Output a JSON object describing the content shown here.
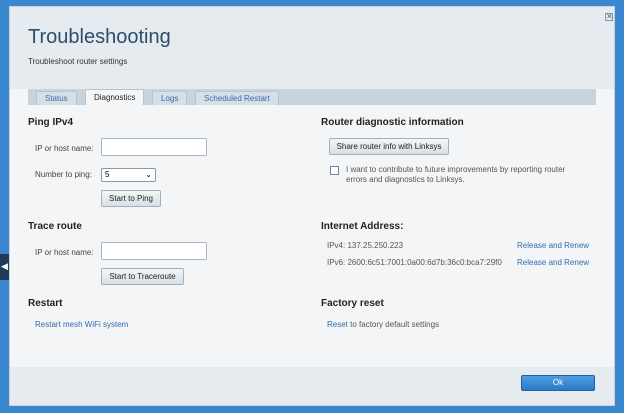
{
  "header": {
    "title": "Troubleshooting",
    "subtitle": "Troubleshoot router settings"
  },
  "tabs": [
    {
      "label": "Status"
    },
    {
      "label": "Diagnostics"
    },
    {
      "label": "Logs"
    },
    {
      "label": "Scheduled Restart"
    }
  ],
  "ping": {
    "title": "Ping IPv4",
    "host_label": "IP or host name:",
    "host_value": "",
    "count_label": "Number to ping:",
    "count_value": "5",
    "button": "Start to Ping"
  },
  "trace": {
    "title": "Trace route",
    "host_label": "IP or host name:",
    "host_value": "",
    "button": "Start to Traceroute"
  },
  "restart": {
    "title": "Restart",
    "link": "Restart mesh WiFi system"
  },
  "router_diag": {
    "title": "Router diagnostic information",
    "share_button": "Share router info with Linksys",
    "consent_line1": "I want to contribute to future improvements by reporting router",
    "consent_line2": "errors and diagnostics to Linksys."
  },
  "internet": {
    "title": "Internet Address:",
    "ipv4": "IPv4: 137.25.250.223",
    "ipv6": "IPv6: 2600:6c51:7001:0a00:6d7b:36c0:bca7:29f0",
    "release_renew": "Release and Renew"
  },
  "factory": {
    "title": "Factory reset",
    "reset_link": "Reset",
    "reset_text": "to factory default settings"
  },
  "footer": {
    "ok": "Ok"
  },
  "close_icon": "close-icon",
  "accent_color": "#2f6fae"
}
